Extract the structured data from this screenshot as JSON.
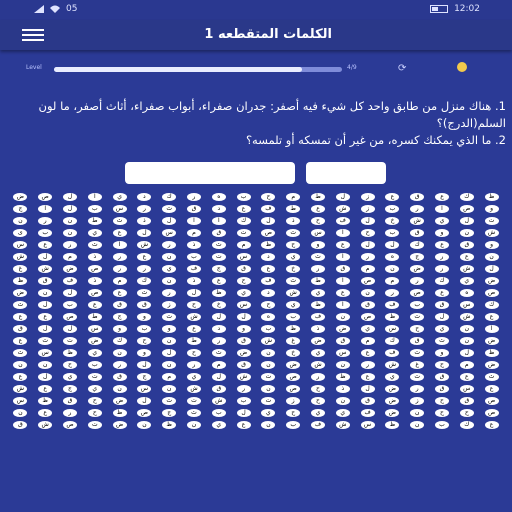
{
  "status": {
    "left_text": "05",
    "time": "12:02"
  },
  "app": {
    "title": "الكلمات المتقطعه 1"
  },
  "progress": {
    "label": "Level",
    "count": "4/9",
    "fraction": 0.86
  },
  "questions": [
    "1. هناك منزل من طابق واحد كل شيء فيه أصفر: جدران صفراء، أبواب صفراء، أثاث أصفر، ما لون السلم(الدرج)؟",
    "2. ما الذي يمكنك كسره، من غير أن تمسكه أو تلمسه؟"
  ],
  "grid": {
    "cols": 20,
    "rows": [
      [
        "ض",
        "ص",
        "ل",
        "ا",
        "ي",
        "د",
        "ك",
        "ر",
        "ه",
        "ب",
        "ح",
        "م",
        "ط",
        "ل",
        "ز",
        "ع",
        "ق",
        "ع",
        "ك",
        "ظ"
      ],
      [
        "ج",
        "ا",
        "ل",
        "ب",
        "س",
        "ر",
        "ث",
        "ق",
        "د",
        "ع",
        "ف",
        "ط",
        "ع",
        "ش",
        "ز",
        "ب",
        "ر",
        "ا",
        "ص",
        "و"
      ],
      [
        "ن",
        "ر",
        "ن",
        "ط",
        "ث",
        "ذ",
        "ل",
        "ا",
        "ا",
        "ك",
        "ل",
        "ذ",
        "ح",
        "ف",
        "ل",
        "خ",
        "ش",
        "ي",
        "ل",
        "ت"
      ],
      [
        "ى",
        "ب",
        "ن",
        "ي",
        "ع",
        "ل",
        "س",
        "م",
        "ق",
        "ت",
        "ص",
        "ث",
        "س",
        "ا",
        "ح",
        "ب",
        "ق",
        "و",
        "ن",
        "ش"
      ],
      [
        "س",
        "ع",
        "ر",
        "ث",
        "ا",
        "ش",
        "ر",
        "ذ",
        "ث",
        "م",
        "ظ",
        "ح",
        "و",
        "ع",
        "ل",
        "ل",
        "ك",
        "ع",
        "ق",
        "و"
      ],
      [
        "ش",
        "ل",
        "م",
        "ذ",
        "ر",
        "ع",
        "ن",
        "ب",
        "ت",
        "س",
        "د",
        "ي",
        "ث",
        "ا",
        "ر",
        "ه",
        "ج",
        "ر",
        "ع",
        "ن"
      ],
      [
        "غ",
        "ش",
        "ض",
        "ص",
        "ر",
        "ر",
        "ي",
        "ف",
        "ج",
        "ق",
        "ع",
        "خ",
        "ر",
        "ق",
        "م",
        "ن",
        "ض",
        "ر",
        "ش",
        "ل"
      ],
      [
        "ظ",
        "ق",
        "ف",
        "ذ",
        "م",
        "ك",
        "ن",
        "ذ",
        "ع",
        "ح",
        "ف",
        "ث",
        "ط",
        "ا",
        "ص",
        "م",
        "ر",
        "ك",
        "ي",
        "ض"
      ],
      [
        "ض",
        "ن",
        "ل",
        "ص",
        "ع",
        "ث",
        "ر",
        "ل",
        "ظ",
        "ي",
        "د",
        "ش",
        "ي",
        "ع",
        "ن",
        "ر",
        "ص",
        "ع",
        "ه",
        "ص"
      ],
      [
        "ث",
        "ل",
        "ب",
        "ع",
        "ق",
        "ق",
        "ز",
        "ح",
        "خ",
        "س",
        "ح",
        "ي",
        "ظ",
        "ا",
        "ق",
        "ف",
        "ب",
        "ق",
        "س",
        "ك"
      ],
      [
        "ع",
        "ع",
        "ص",
        "ط",
        "ج",
        "و",
        "ث",
        "ش",
        "ل",
        "ل",
        "ه",
        "ب",
        "ف",
        "ن",
        "ص",
        "ظ",
        "ث",
        "ل",
        "ش",
        "ع"
      ],
      [
        "ق",
        "ل",
        "ل",
        "س",
        "و",
        "ب",
        "و",
        "ع",
        "د",
        "و",
        "ب",
        "ظ",
        "ذ",
        "ض",
        "ي",
        "س",
        "ح",
        "ي",
        "ن",
        "ا"
      ],
      [
        "ع",
        "ث",
        "ت",
        "ض",
        "ك",
        "ح",
        "ن",
        "ط",
        "ر",
        "ق",
        "ش",
        "غ",
        "ض",
        "ق",
        "م",
        "ك",
        "ق",
        "ث",
        "ن",
        "ض"
      ],
      [
        "ث",
        "س",
        "ظ",
        "ي",
        "ن",
        "و",
        "ل",
        "ح",
        "ث",
        "ض",
        "ن",
        "خ",
        "ي",
        "س",
        "ع",
        "ف",
        "ث",
        "و",
        "ل",
        "ظ"
      ],
      [
        "ن",
        "ن",
        "ح",
        "ب",
        "ر",
        "ل",
        "ن",
        "ر",
        "م",
        "ق",
        "ن",
        "ض",
        "ش",
        "ن",
        "ر",
        "ش",
        "غ",
        "ح",
        "م",
        "ض"
      ],
      [
        "ع",
        "ل",
        "ي",
        "ت",
        "ق",
        "ج",
        "م",
        "ي",
        "ل",
        "ش",
        "ت",
        "ص",
        "ر",
        "ظ",
        "ع",
        "ي",
        "ث",
        "ق",
        "ع",
        "ث"
      ],
      [
        "ش",
        "ع",
        "ج",
        "ي",
        "ن",
        "س",
        "ن",
        "ش",
        "ق",
        "ر",
        "ن",
        "ص",
        "ح",
        "ذ",
        "ل",
        "ض",
        "ر",
        "ق",
        "س",
        "ع"
      ],
      [
        "س",
        "ظ",
        "ق",
        "ح",
        "ض",
        "ل",
        "ث",
        "ت",
        "ش",
        "ب",
        "ت",
        "ز",
        "ح",
        "ن",
        "ق",
        "ض",
        "ز",
        "ح",
        "ق",
        "ص"
      ],
      [
        "ن",
        "ع",
        "ر",
        "ح",
        "ظ",
        "ص",
        "ج",
        "ث",
        "ب",
        "ل",
        "ي",
        "ح",
        "ي",
        "ي",
        "ف",
        "ض",
        "ن",
        "ح",
        "ح",
        "ص"
      ],
      [
        "ق",
        "ش",
        "ص",
        "ت",
        "ض",
        "ن",
        "ظ",
        "ن",
        "ي",
        "ع",
        "ن",
        "ب",
        "ف",
        "ش",
        "س",
        "ظ",
        "ن",
        "ب",
        "ك",
        "ع"
      ]
    ]
  }
}
